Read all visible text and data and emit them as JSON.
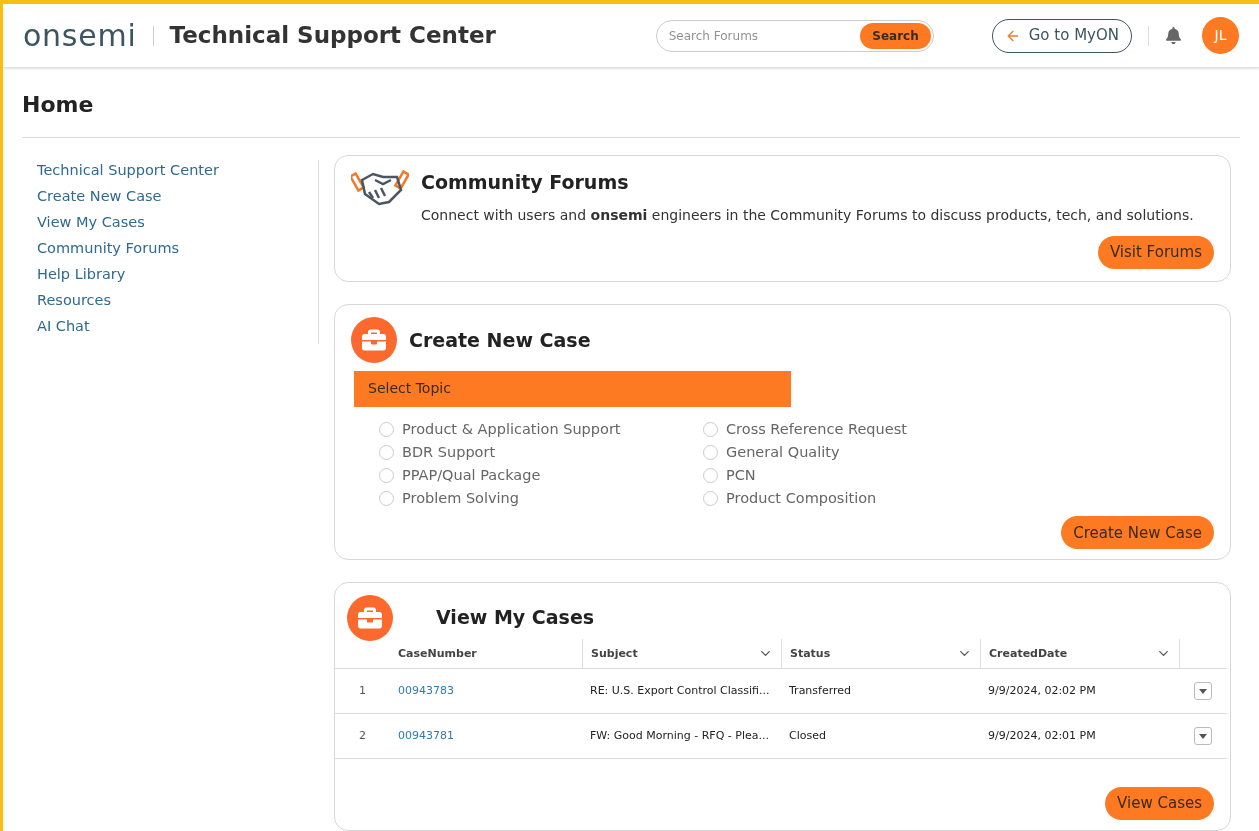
{
  "header": {
    "logo": "onsemi",
    "title": "Technical Support Center",
    "search": {
      "placeholder": "Search Forums",
      "button": "Search"
    },
    "myon_button": "Go to MyON",
    "avatar": "JL"
  },
  "page_title": "Home",
  "sidebar": {
    "items": [
      {
        "label": "Technical Support Center"
      },
      {
        "label": "Create New Case"
      },
      {
        "label": "View My Cases"
      },
      {
        "label": "Community Forums"
      },
      {
        "label": "Help Library"
      },
      {
        "label": "Resources"
      },
      {
        "label": "AI Chat"
      }
    ]
  },
  "forums_card": {
    "title": "Community Forums",
    "text": "Connect with users and **onsemi** engineers in the Community Forums to discuss products, tech, and solutions.",
    "button": "Visit Forums"
  },
  "case_card": {
    "title": "Create New Case",
    "topic_header": "Select Topic",
    "topics": [
      {
        "label": "Product & Application Support",
        "selected": false
      },
      {
        "label": "BDR Support",
        "selected": false
      },
      {
        "label": "PPAP/Qual Package",
        "selected": false
      },
      {
        "label": "Problem Solving",
        "selected": false
      },
      {
        "label": "Cross Reference Request",
        "selected": false
      },
      {
        "label": "General Quality",
        "selected": false
      },
      {
        "label": "PCN",
        "selected": false
      },
      {
        "label": "Product Composition",
        "selected": false
      }
    ],
    "button": "Create New Case"
  },
  "cases_card": {
    "title": "View My Cases",
    "table": {
      "columns": [
        {
          "label": "CaseNumber",
          "sortable": false
        },
        {
          "label": "Subject",
          "sortable": true
        },
        {
          "label": "Status",
          "sortable": true
        },
        {
          "label": "CreatedDate",
          "sortable": true
        }
      ],
      "rows": [
        {
          "index": "1",
          "case_number": "00943783",
          "subject": "RE: U.S. Export Control Classifi...",
          "status": "Transferred",
          "created": "9/9/2024, 02:02 PM"
        },
        {
          "index": "2",
          "case_number": "00943781",
          "subject": "FW: Good Morning - RFQ - Plea...",
          "status": "Closed",
          "created": "9/9/2024, 02:01 PM"
        }
      ]
    },
    "button": "View Cases"
  }
}
